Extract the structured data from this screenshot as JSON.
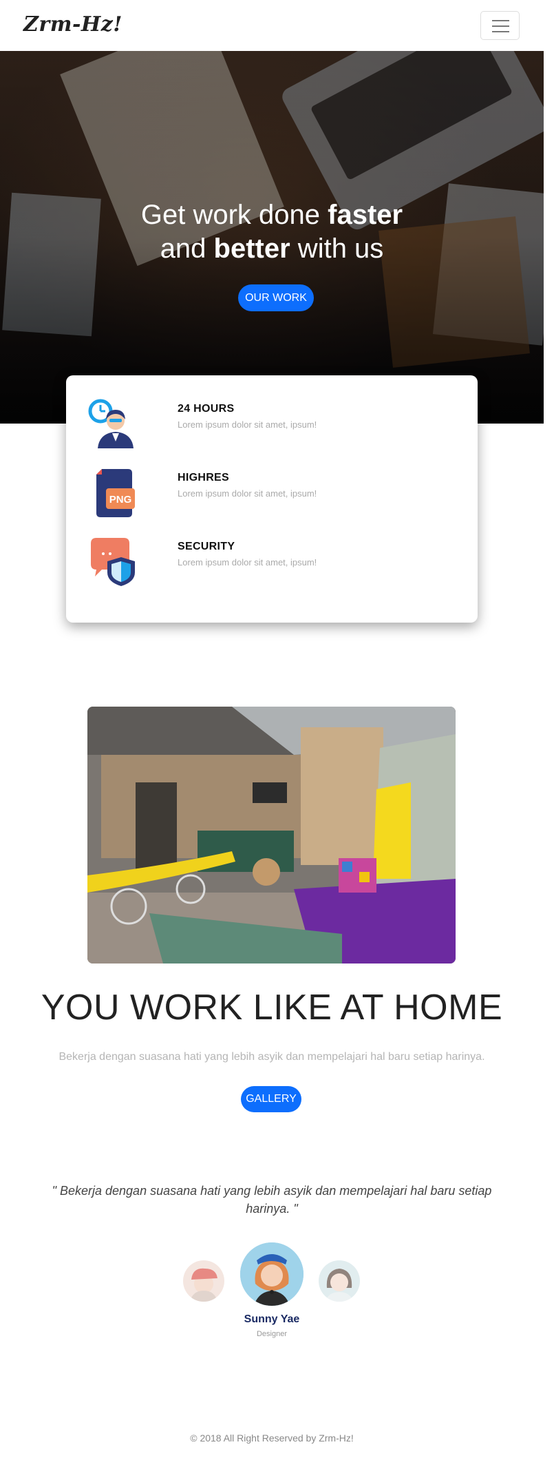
{
  "navbar": {
    "brand": "Zrm-Hz!",
    "menu_icon": "hamburger-menu-icon"
  },
  "hero": {
    "title_line1_normal": "Get work done ",
    "title_line1_bold": "faster",
    "title_line2_a": "and ",
    "title_line2_bold": "better",
    "title_line2_b": " with us",
    "button_label": "OUR WORK"
  },
  "features": [
    {
      "icon": "clock-support-person-icon",
      "title": "24 HOURS",
      "desc": "Lorem ipsum dolor sit amet, ipsum!"
    },
    {
      "icon": "png-file-icon",
      "title": "HIGHRES",
      "desc": "Lorem ipsum dolor sit amet, ipsum!"
    },
    {
      "icon": "chat-shield-icon",
      "title": "SECURITY",
      "desc": "Lorem ipsum dolor sit amet, ipsum!"
    }
  ],
  "workspace": {
    "title_a": "YOU ",
    "title_b": "WORK",
    "title_c": " LIKE AT ",
    "title_d": "HOME",
    "text": "Bekerja dengan suasana hati yang lebih asyik dan mempelajari hal baru setiap harinya.",
    "button_label": "GALLERY"
  },
  "testimonial": {
    "quote": "\" Bekerja dengan suasana hati yang lebih asyik dan mempelajari hal baru setiap harinya. \"",
    "name": "Sunny Yae",
    "role": "Designer"
  },
  "footer": {
    "text": "© 2018 All Right Reserved by Zrm-Hz!"
  },
  "colors": {
    "primary": "#0d6efd",
    "name_color": "#1a2a63"
  }
}
